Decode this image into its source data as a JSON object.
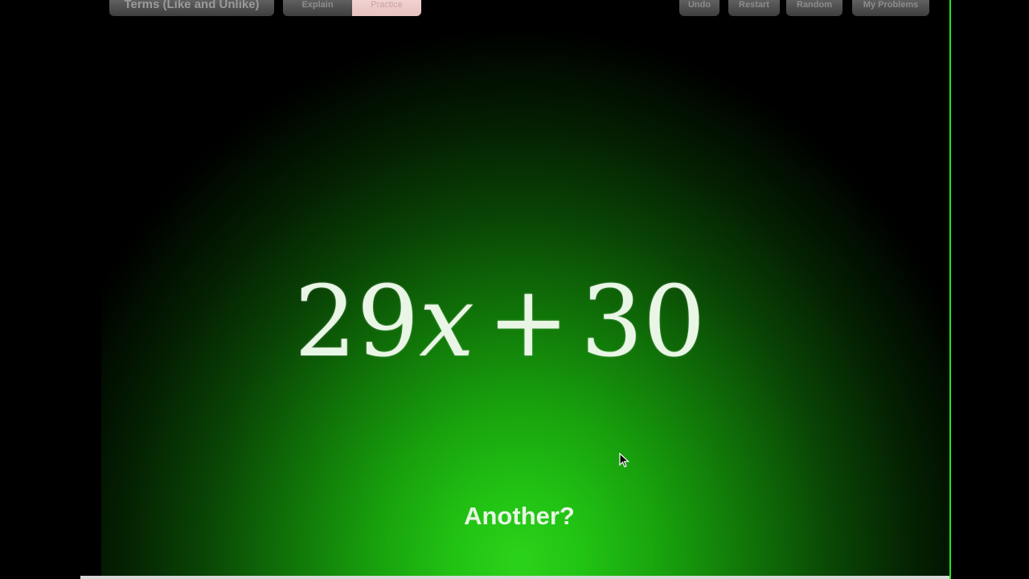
{
  "toolbar": {
    "title": "Terms (Like and Unlike)",
    "modes": {
      "explain": "Explain",
      "practice": "Practice",
      "selected": "Practice"
    },
    "undo": "Undo",
    "restart": "Restart",
    "random": "Random",
    "my_problems": "My Problems"
  },
  "problem": {
    "coefficient": "29",
    "variable": "x",
    "operator": "+",
    "constant": "30"
  },
  "another_label": "Another?",
  "colors": {
    "glow": "#2bd21a",
    "background": "#000000",
    "accent_border": "#1ee81e"
  }
}
